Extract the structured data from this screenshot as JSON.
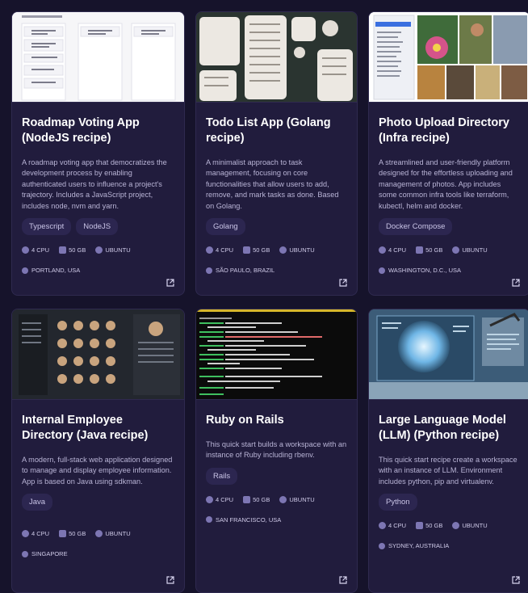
{
  "cards": [
    {
      "title": "Roadmap Voting App (NodeJS recipe)",
      "description": "A roadmap voting app that democratizes the development process by enabling authenticated users to influence a project's trajectory. Includes a JavaScript project, includes node, nvm and yarn.",
      "tags": [
        "Typescript",
        "NodeJS"
      ],
      "cpu": "4 CPU",
      "storage": "50 GB",
      "os": "UBUNTU",
      "location": "PORTLAND, USA",
      "thumb_icon": "kanban-board-screenshot"
    },
    {
      "title": "Todo List App (Golang recipe)",
      "description": "A minimalist approach to task management, focusing on core functionalities that allow users to add, remove, and mark tasks as done. Based on Golang.",
      "tags": [
        "Golang"
      ],
      "cpu": "4 CPU",
      "storage": "50 GB",
      "os": "UBUNTU",
      "location": "SÃO PAULO, BRAZIL",
      "thumb_icon": "mobile-ui-mockup"
    },
    {
      "title": "Photo Upload Directory (Infra recipe)",
      "description": "A streamlined and user-friendly platform designed for the effortless uploading and management of photos. App includes some common infra tools like terraform, kubectl, helm and docker.",
      "tags": [
        "Docker Compose"
      ],
      "cpu": "4 CPU",
      "storage": "50 GB",
      "os": "UBUNTU",
      "location": "WASHINGTON, D.C., USA",
      "thumb_icon": "photo-gallery-screenshot"
    },
    {
      "title": "Internal Employee Directory (Java recipe)",
      "description": "A modern, full-stack web application designed to manage and display employee information. App is based on Java using sdkman.",
      "tags": [
        "Java"
      ],
      "cpu": "4 CPU",
      "storage": "50 GB",
      "os": "UBUNTU",
      "location": "SINGAPORE",
      "thumb_icon": "employee-directory-screenshot"
    },
    {
      "title": "Ruby on Rails",
      "description": "This quick start builds a workspace with an instance of Ruby including rbenv.",
      "tags": [
        "Rails"
      ],
      "cpu": "4 CPU",
      "storage": "50 GB",
      "os": "UBUNTU",
      "location": "SAN FRANCISCO, USA",
      "thumb_icon": "terminal-code-screenshot"
    },
    {
      "title": "Large Language Model (LLM) (Python recipe)",
      "description": "This quick start recipe create a workspace with an instance of LLM. Environment includes python, pip and virtualenv.",
      "tags": [
        "Python"
      ],
      "cpu": "4 CPU",
      "storage": "50 GB",
      "os": "UBUNTU",
      "location": "SYDNEY, AUSTRALIA",
      "thumb_icon": "ai-brain-illustration"
    }
  ],
  "colors": {
    "background": "#16132b",
    "card": "#211c3d",
    "tag": "#2c2650",
    "accent_icon": "#7d76b3"
  }
}
